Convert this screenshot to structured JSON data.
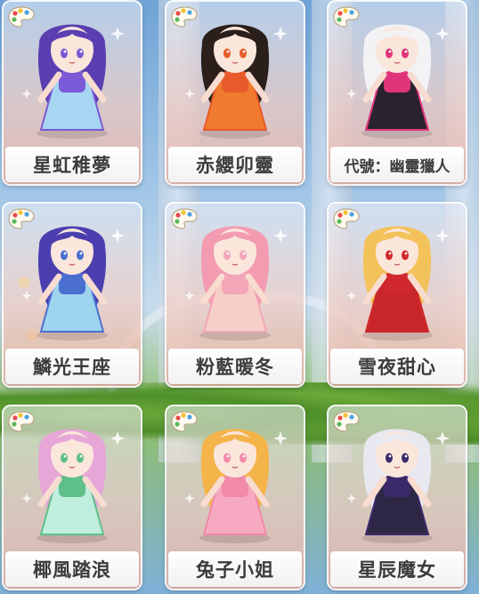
{
  "outfits": [
    {
      "name": "星虹稚夢",
      "icon": "palette-icon",
      "theme": "#7a5ad6",
      "hair": "#5b3fb0",
      "dress": "#a7d6f2"
    },
    {
      "name": "赤纓卯靈",
      "icon": "palette-icon",
      "theme": "#e85a2a",
      "hair": "#2b1f1c",
      "dress": "#f07a2e"
    },
    {
      "name": "代號：幽靈獵人",
      "icon": "palette-icon",
      "theme": "#e0357a",
      "hair": "#f3f3f6",
      "dress": "#2b2230"
    },
    {
      "name": "鱗光王座",
      "icon": "palette-icon",
      "theme": "#4a6fd1",
      "hair": "#4b3fb0",
      "dress": "#9fd4ee"
    },
    {
      "name": "粉藍暖冬",
      "icon": "palette-icon",
      "theme": "#f2a6b8",
      "hair": "#f39bb0",
      "dress": "#f7cfc8"
    },
    {
      "name": "雪夜甜心",
      "icon": "palette-icon",
      "theme": "#d0282e",
      "hair": "#f4c25a",
      "dress": "#c8262a"
    },
    {
      "name": "椰風踏浪",
      "icon": "palette-icon",
      "theme": "#5fbf8a",
      "hair": "#e6a6d8",
      "dress": "#bfeede"
    },
    {
      "name": "兔子小姐",
      "icon": "palette-icon",
      "theme": "#f08aa8",
      "hair": "#f5b44a",
      "dress": "#f7a9c2"
    },
    {
      "name": "星辰魔女",
      "icon": "palette-icon",
      "theme": "#3a2a6a",
      "hair": "#e8e8f0",
      "dress": "#2d2745"
    }
  ]
}
